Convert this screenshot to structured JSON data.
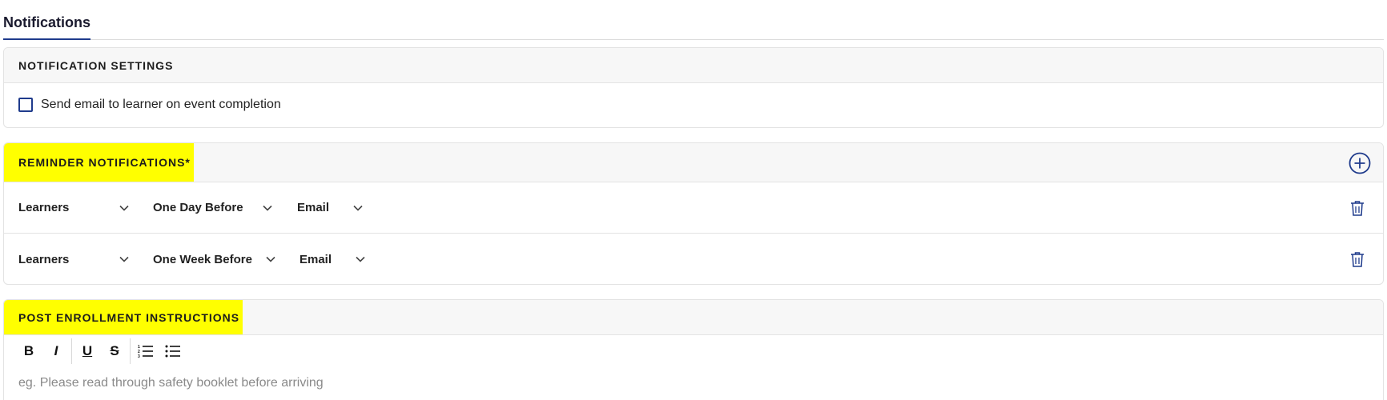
{
  "tabs": {
    "active_label": "Notifications"
  },
  "notification_settings": {
    "title": "NOTIFICATION SETTINGS",
    "checkbox_label": "Send email to learner on event completion",
    "checked": false
  },
  "reminder_notifications": {
    "title": "REMINDER NOTIFICATIONS*",
    "add_icon": "plus-circle-icon",
    "rows": [
      {
        "recipient": "Learners",
        "timing": "One Day Before",
        "channel": "Email"
      },
      {
        "recipient": "Learners",
        "timing": "One Week Before",
        "channel": "Email"
      }
    ],
    "delete_icon": "trash-icon"
  },
  "post_enrollment": {
    "title": "POST ENROLLMENT INSTRUCTIONS",
    "toolbar": [
      {
        "label": "B",
        "icon": "bold-icon"
      },
      {
        "label": "I",
        "icon": "italic-icon"
      },
      {
        "label": "U",
        "icon": "underline-icon"
      },
      {
        "label": "S",
        "icon": "strikethrough-icon"
      },
      {
        "icon": "ordered-list-icon"
      },
      {
        "icon": "bullet-list-icon"
      }
    ],
    "placeholder": "eg. Please read through safety booklet before arriving"
  },
  "colors": {
    "accent": "#1f3b8c",
    "highlight": "#ffff00"
  }
}
